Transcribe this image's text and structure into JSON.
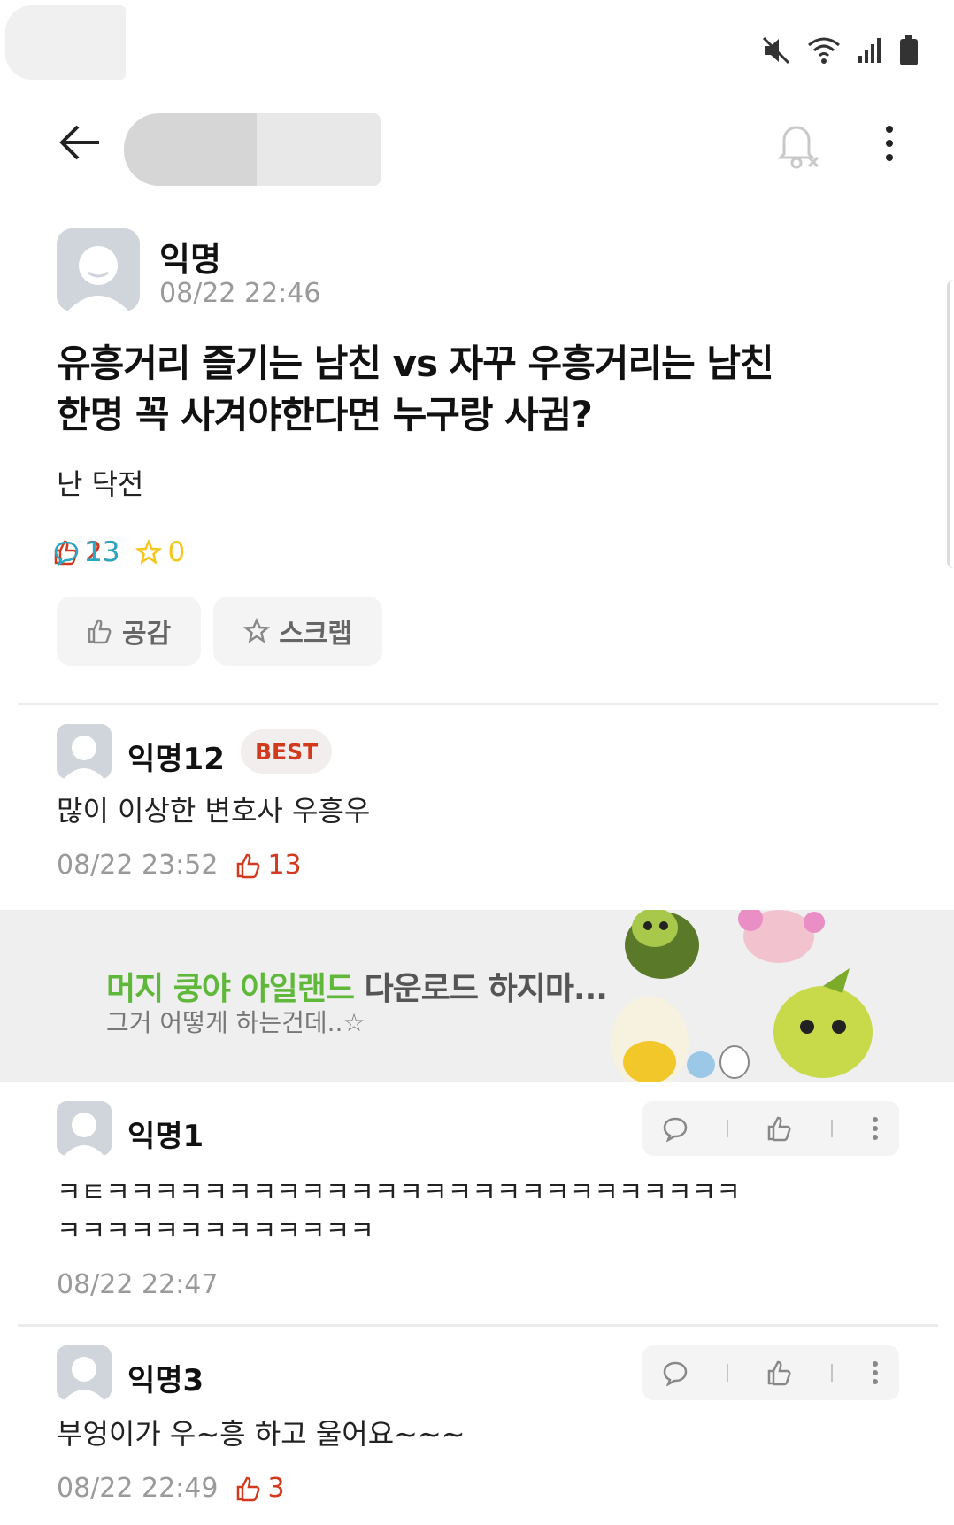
{
  "header": {
    "board_name": "",
    "icons": [
      "back-arrow-icon",
      "bell-off-icon",
      "more-vertical-icon"
    ]
  },
  "status_bar": {
    "icons": [
      "mute-icon",
      "wifi-icon",
      "signal-icon",
      "battery-icon"
    ]
  },
  "post": {
    "author": "익명",
    "time": "08/22 22:46",
    "title_line1": "유흥거리 즐기는 남친 vs 자꾸 우흥거리는 남친",
    "title_line2": "한명 꼭 사겨야한다면 누구랑 사귐?",
    "body": "난 닥전",
    "likes": "23",
    "comments": "13",
    "scraps": "0",
    "like_button": "공감",
    "scrap_button": "스크랩"
  },
  "best_comment": {
    "author": "익명12",
    "badge": "BEST",
    "text": "많이 이상한 변호사 우흥우",
    "time": "08/22 23:52",
    "likes": "13"
  },
  "ad": {
    "title_brand": "머지 쿵야 아일랜드",
    "title_rest": " 다운로드 하지마...",
    "subtitle": "그거 어떻게 하는건데..☆"
  },
  "comments": [
    {
      "author": "익명1",
      "text_line1": "ㅋㅌㅋㅋㅋㅋㅋㅋㅋㅋㅋㅋㅋㅋㅋㅋㅋㅋㅋㅋㅋㅋㅋㅋㅋㅋㅋㅋ",
      "text_line2": "ㅋㅋㅋㅋㅋㅋㅋㅋㅋㅋㅋㅋㅋ",
      "time": "08/22 22:47"
    },
    {
      "author": "익명3",
      "text_line1": "부엉이가 우~흥 하고 울어요~~~",
      "time": "08/22 22:49",
      "likes": "3"
    }
  ],
  "colors": {
    "like_red": "#d23a1e",
    "comment_teal": "#27a7c4",
    "scrap_yellow": "#f5c518",
    "ad_brand_green": "#5fb83a"
  }
}
